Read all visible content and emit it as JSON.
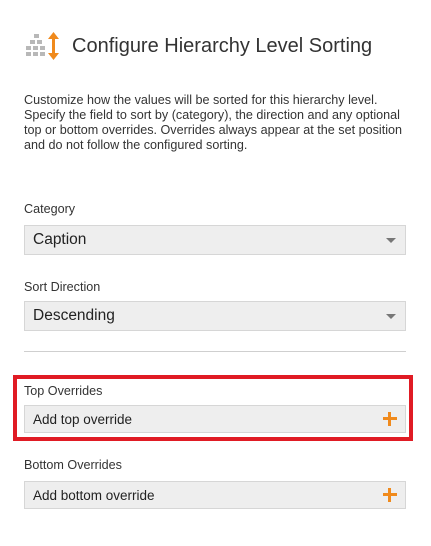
{
  "header": {
    "title": "Configure Hierarchy Level Sorting",
    "icon": "hierarchy-sort-icon",
    "icon_accent_color": "#f08a1c"
  },
  "description": "Customize how the values will be sorted for this hierarchy level. Specify the field to sort by (category), the direction and any optional top or bottom overrides. Overrides always appear at the set position and do not follow the configured sorting.",
  "category": {
    "label": "Category",
    "value": "Caption"
  },
  "sort_direction": {
    "label": "Sort Direction",
    "value": "Descending"
  },
  "top_overrides": {
    "label": "Top Overrides",
    "add_text": "Add top override"
  },
  "bottom_overrides": {
    "label": "Bottom Overrides",
    "add_text": "Add bottom override"
  },
  "colors": {
    "accent": "#f08a1c",
    "highlight": "#e01b24"
  }
}
